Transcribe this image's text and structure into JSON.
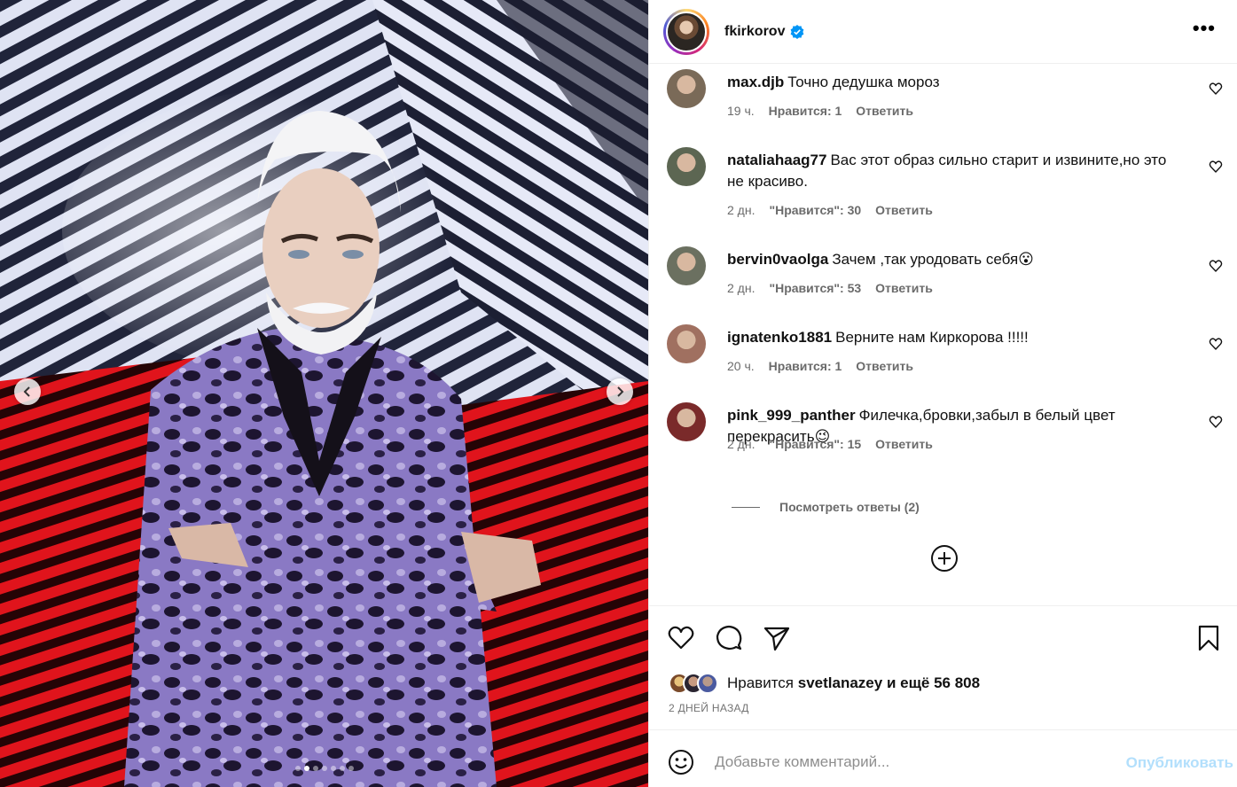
{
  "post": {
    "username": "fkirkorov",
    "more_label": "•••"
  },
  "media": {
    "slide_count": 7,
    "active_slide": 2
  },
  "comments": [
    {
      "username": "max.djb",
      "text": "Точно дедушка мороз",
      "time": "19 ч.",
      "likes": "Нравится: 1",
      "reply": "Ответить",
      "avatar_color": "#7a6a58"
    },
    {
      "username": "nataliahaag77",
      "text": "Вас этот образ сильно старит и извините,но это не красиво.",
      "time": "2 дн.",
      "likes": "\"Нравится\": 30",
      "reply": "Ответить",
      "avatar_color": "#5c6652"
    },
    {
      "username": "bervin0vaolga",
      "text": "Зачем ,так уродовать себя",
      "emoji": "😮",
      "time": "2 дн.",
      "likes": "\"Нравится\": 53",
      "reply": "Ответить",
      "avatar_color": "#6b7060"
    },
    {
      "username": "ignatenko1881",
      "text": "Верните нам Киркорова !!!!!",
      "time": "20 ч.",
      "likes": "Нравится: 1",
      "reply": "Ответить",
      "avatar_color": "#a07060"
    },
    {
      "username": "pink_999_panther",
      "text": "Филечка,бровки,забыл в белый цвет перекрасить",
      "emoji": "😉",
      "time": "2 дн.",
      "likes": "\"Нравится\": 15",
      "reply": "Ответить",
      "avatar_color": "#7a2a2a"
    }
  ],
  "view_replies": "Посмотреть ответы (2)",
  "likes": {
    "prefix": "Нравится",
    "user": "svetlanazey",
    "suffix": "и ещё 56 808"
  },
  "date": "2 ДНЕЙ НАЗАД",
  "composer": {
    "placeholder": "Добавьте комментарий...",
    "publish": "Опубликовать"
  },
  "colors": {
    "accent": "#0095f6",
    "publish_disabled": "#b2dffc",
    "secondary_text": "#6b6b6b"
  },
  "icons": {
    "verified": "verified-badge-icon",
    "like": "heart-icon",
    "comment": "comment-bubble-icon",
    "share": "paper-plane-icon",
    "save": "bookmark-icon",
    "emoji": "smiley-icon",
    "load_more": "plus-circle-icon"
  }
}
